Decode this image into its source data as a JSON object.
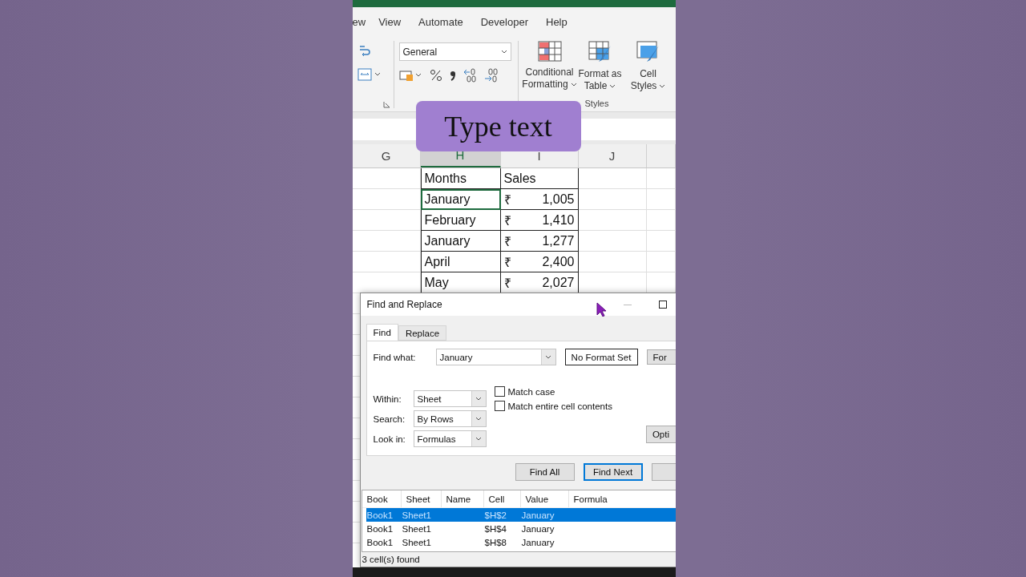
{
  "ribbon": {
    "tabs": [
      {
        "label": "ew",
        "selected": false
      },
      {
        "label": "View",
        "selected": false
      },
      {
        "label": "Automate",
        "selected": false
      },
      {
        "label": "Developer",
        "selected": false
      },
      {
        "label": "Help",
        "selected": false
      }
    ],
    "number_format": "General",
    "style_buttons": [
      {
        "kind": "conditional",
        "line1": "Conditional",
        "line2": "Formatting"
      },
      {
        "kind": "table",
        "line1": "Format as",
        "line2": "Table"
      },
      {
        "kind": "cellstyle",
        "line1": "Cell",
        "line2": "Styles"
      }
    ],
    "group_label": "Styles"
  },
  "overlay_label": "Type text",
  "sheet": {
    "columns": [
      {
        "label": "G",
        "selected": false
      },
      {
        "label": "H",
        "selected": true
      },
      {
        "label": "I",
        "selected": false
      },
      {
        "label": "J",
        "selected": false
      }
    ],
    "header": {
      "month": "Months",
      "sales": "Sales"
    },
    "rows": [
      {
        "month": "January",
        "currency": "₹",
        "amount": "1,005",
        "active": true
      },
      {
        "month": "February",
        "currency": "₹",
        "amount": "1,410",
        "active": false
      },
      {
        "month": "January",
        "currency": "₹",
        "amount": "1,277",
        "active": false
      },
      {
        "month": "April",
        "currency": "₹",
        "amount": "2,400",
        "active": false
      },
      {
        "month": "May",
        "currency": "₹",
        "amount": "2,027",
        "active": false
      }
    ]
  },
  "dialog": {
    "title": "Find and Replace",
    "tabs": [
      {
        "label": "Find",
        "selected": true
      },
      {
        "label": "Replace",
        "selected": false
      }
    ],
    "find_what": {
      "label": "Find what:",
      "value": "January"
    },
    "format_preview": "No Format Set",
    "format_button": "For",
    "selects": [
      {
        "label": "Within:",
        "value": "Sheet"
      },
      {
        "label": "Search:",
        "value": "By Rows"
      },
      {
        "label": "Look in:",
        "value": "Formulas"
      }
    ],
    "checkboxes": [
      {
        "label": "Match case",
        "checked": false
      },
      {
        "label": "Match entire cell contents",
        "checked": false
      }
    ],
    "options_button": "Opti",
    "buttons": [
      {
        "label": "Find All",
        "default": false
      },
      {
        "label": "Find Next",
        "default": true
      },
      {
        "default": false
      }
    ],
    "results": {
      "columns": [
        "Book",
        "Sheet",
        "Name",
        "Cell",
        "Value",
        "Formula"
      ],
      "rows": [
        {
          "cells": [
            "Book1",
            "Sheet1",
            "",
            "$H$2",
            "January",
            ""
          ],
          "selected": true
        },
        {
          "cells": [
            "Book1",
            "Sheet1",
            "",
            "$H$4",
            "January",
            ""
          ],
          "selected": false
        },
        {
          "cells": [
            "Book1",
            "Sheet1",
            "",
            "$H$8",
            "January",
            ""
          ],
          "selected": false
        }
      ]
    },
    "status": "3 cell(s) found"
  }
}
